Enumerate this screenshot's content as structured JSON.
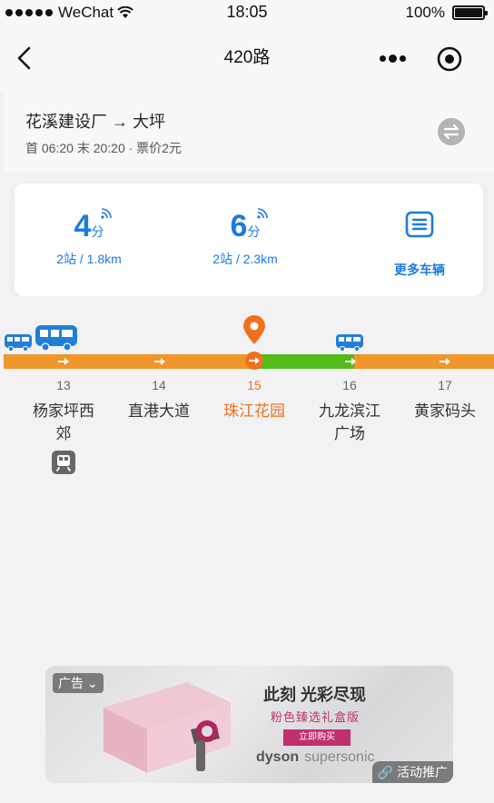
{
  "status_bar": {
    "carrier": "WeChat",
    "time": "18:05",
    "battery": "100%"
  },
  "nav": {
    "title": "420路"
  },
  "route": {
    "direction": "花溪建设厂 → 大坪",
    "times": "首 06:20 末 20:20 · 票价2元"
  },
  "eta": [
    {
      "value": "4",
      "unit": "分",
      "detail": "2站 / 1.8km"
    },
    {
      "value": "6",
      "unit": "分",
      "detail": "2站 / 2.3km"
    }
  ],
  "more_vehicles": "更多车辆",
  "stops": [
    {
      "num": "13",
      "name": "杨家坪西郊",
      "metro": true
    },
    {
      "num": "14",
      "name": "直港大道"
    },
    {
      "num": "15",
      "name": "珠江花园",
      "current": true
    },
    {
      "num": "16",
      "name": "九龙滨江广场"
    },
    {
      "num": "17",
      "name": "黄家码头"
    }
  ],
  "colors": {
    "accent": "#1a7be0",
    "track_orange": "#f0962a",
    "track_green": "#52bc1a",
    "current": "#f07020",
    "bus": "#1f7fd6"
  },
  "ad": {
    "tag": "广告",
    "headline": "此刻 光彩尽现",
    "subline": "粉色臻选礼盒版",
    "button": "立即购买",
    "brand": "dyson",
    "brand_sub": "supersonic",
    "promo": "活动推广"
  }
}
